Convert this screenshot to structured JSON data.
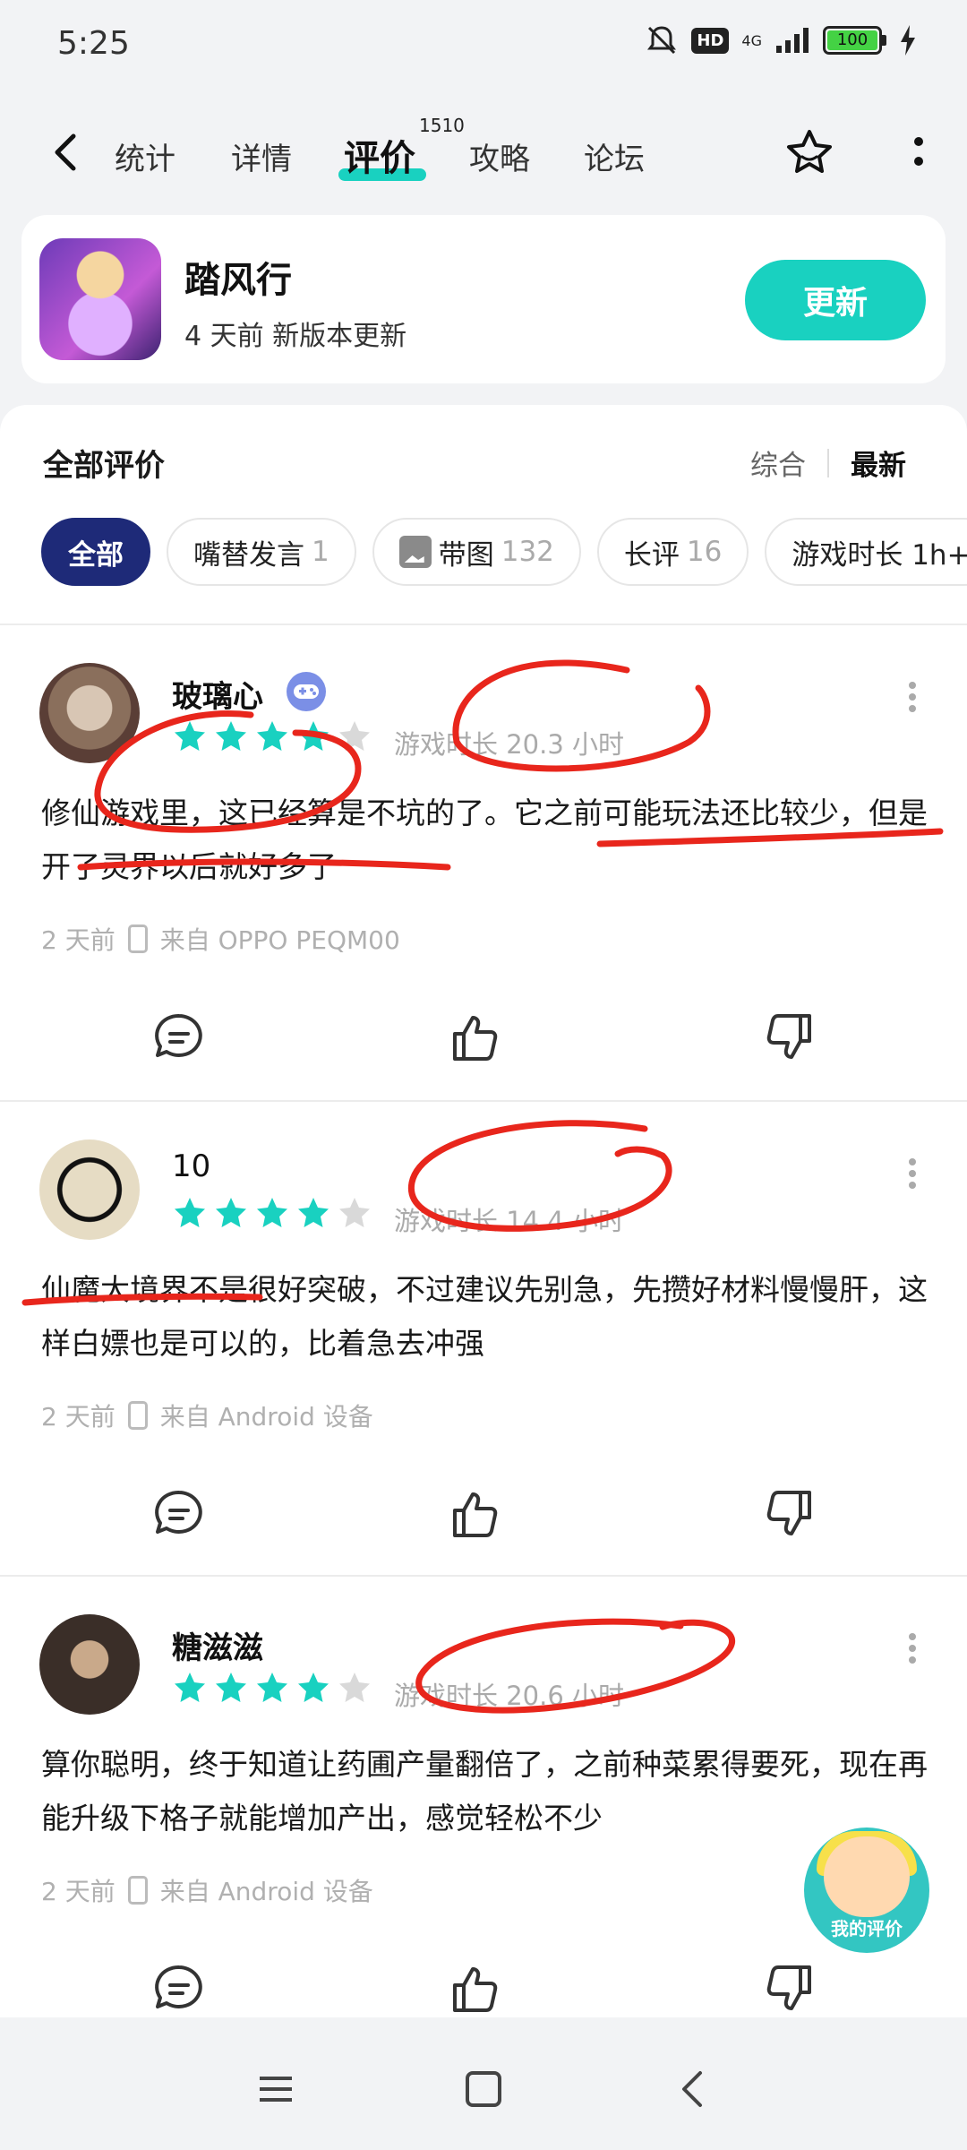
{
  "status_bar": {
    "time": "5:25",
    "hd": "HD",
    "network": "4G",
    "battery": "100"
  },
  "nav": {
    "tabs": [
      {
        "label": "统计"
      },
      {
        "label": "详情"
      },
      {
        "label": "评价",
        "count": "1510"
      },
      {
        "label": "攻略"
      },
      {
        "label": "论坛"
      }
    ],
    "active_tab": "评价"
  },
  "app": {
    "name": "踏风行",
    "subtitle": "4 天前 新版本更新",
    "action_label": "更新"
  },
  "reviews_section": {
    "title": "全部评价",
    "sort_options": [
      "综合",
      "最新"
    ],
    "active_sort": "最新",
    "filters": [
      {
        "label": "全部",
        "count": ""
      },
      {
        "label": "嘴替发言",
        "count": "1"
      },
      {
        "label": "带图",
        "count": "132"
      },
      {
        "label": "长评",
        "count": "16"
      },
      {
        "label": "游戏时长 1h+",
        "count": ""
      }
    ]
  },
  "reviews": [
    {
      "user": "玻璃心",
      "has_badge": true,
      "rating": 4,
      "playtime": "游戏时长 20.3 小时",
      "content": "修仙游戏里，这已经算是不坑的了。它之前可能玩法还比较少，但是开了灵界以后就好多了",
      "time": "2 天前",
      "device": "来自 OPPO PEQM00"
    },
    {
      "user": "10",
      "has_badge": false,
      "rating": 4,
      "playtime": "游戏时长 14.4 小时",
      "content": "仙魔大境界不是很好突破，不过建议先别急，先攒好材料慢慢肝，这样白嫖也是可以的，比着急去冲强",
      "time": "2 天前",
      "device": "来自 Android 设备"
    },
    {
      "user": "糖滋滋",
      "has_badge": false,
      "rating": 4,
      "playtime": "游戏时长 20.6 小时",
      "content": "算你聪明，终于知道让药圃产量翻倍了，之前种菜累得要死，现在再能升级下格子就能增加产出，感觉轻松不少",
      "time": "2 天前",
      "device": "来自 Android 设备"
    }
  ],
  "floating": {
    "label": "我的评价"
  },
  "colors": {
    "accent": "#19d1c0",
    "chip_active": "#1e2a78",
    "annotation": "#e8261c"
  }
}
